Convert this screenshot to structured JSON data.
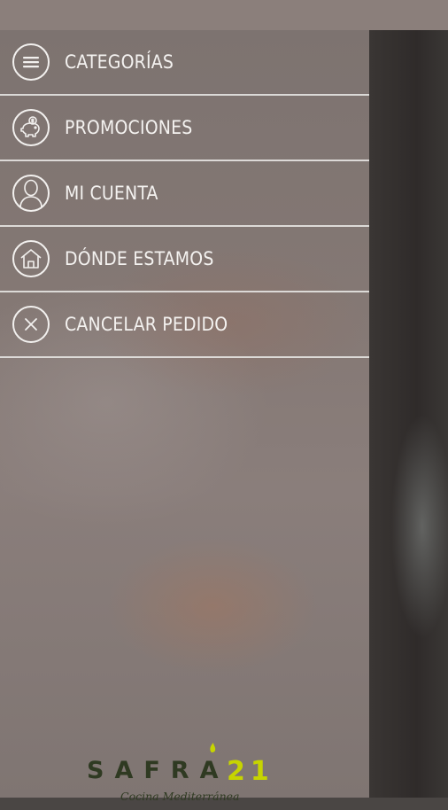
{
  "menu": {
    "items": [
      {
        "label": "CATEGORÍAS",
        "icon": "menu-lines-icon"
      },
      {
        "label": "PROMOCIONES",
        "icon": "piggy-bank-icon"
      },
      {
        "label": "MI CUENTA",
        "icon": "user-icon"
      },
      {
        "label": "DÓNDE ESTAMOS",
        "icon": "home-icon"
      },
      {
        "label": "CANCELAR PEDIDO",
        "icon": "close-icon"
      }
    ]
  },
  "brand": {
    "name": "SAFRA",
    "number": "21",
    "tagline": "Cocina Mediterránea",
    "colors": {
      "name": "#2f3a22",
      "number": "#c6d400"
    }
  }
}
